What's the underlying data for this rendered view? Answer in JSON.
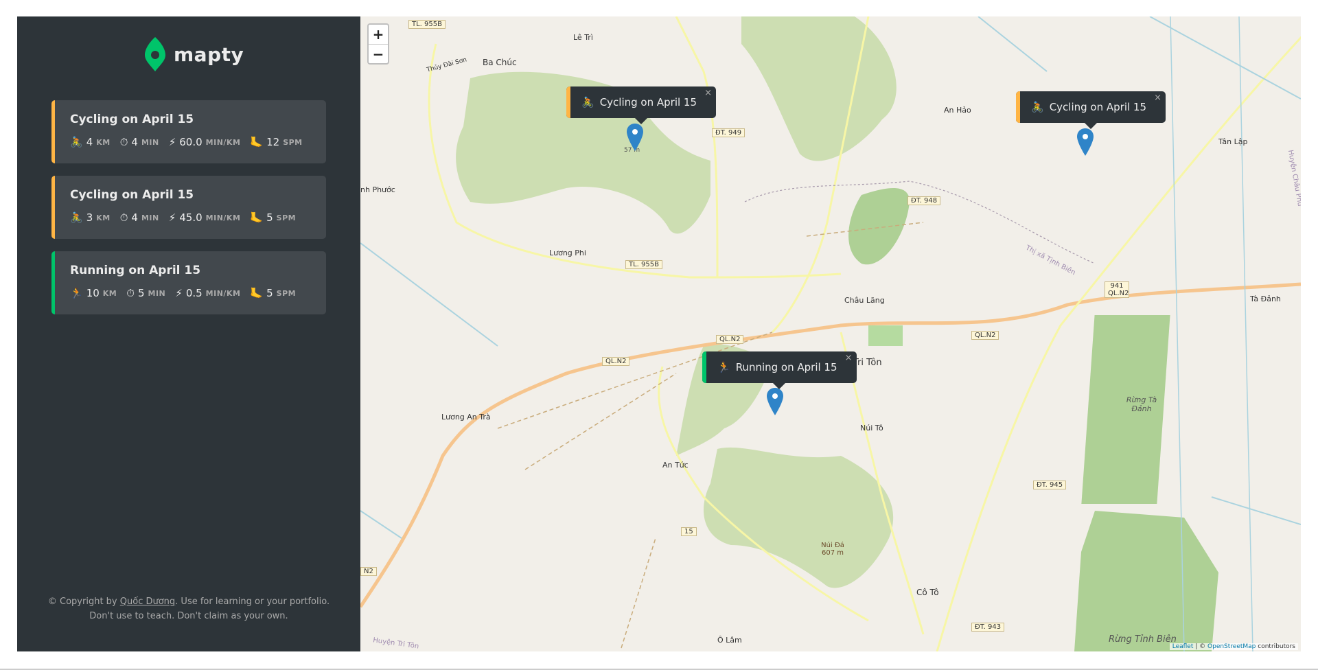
{
  "app": {
    "name": "mapty",
    "accent_cycling": "#ffb545",
    "accent_running": "#00c46a"
  },
  "workouts": [
    {
      "title": "Cycling on April 15",
      "type": "cycling",
      "icon": "🚴",
      "distance": "4",
      "distance_unit": "KM",
      "duration": "4",
      "duration_unit": "MIN",
      "pace": "60.0",
      "pace_unit": "MIN/KM",
      "cadence": "12",
      "cadence_unit": "SPM"
    },
    {
      "title": "Cycling on April 15",
      "type": "cycling",
      "icon": "🚴",
      "distance": "3",
      "distance_unit": "KM",
      "duration": "4",
      "duration_unit": "MIN",
      "pace": "45.0",
      "pace_unit": "MIN/KM",
      "cadence": "5",
      "cadence_unit": "SPM"
    },
    {
      "title": "Running on April 15",
      "type": "running",
      "icon": "🏃",
      "distance": "10",
      "distance_unit": "KM",
      "duration": "5",
      "duration_unit": "MIN",
      "pace": "0.5",
      "pace_unit": "MIN/KM",
      "cadence": "5",
      "cadence_unit": "SPM"
    }
  ],
  "icons": {
    "stopwatch": "⏱",
    "lightning": "⚡",
    "foot": "🦶"
  },
  "copyright": {
    "prefix": "© Copyright by ",
    "author": "Quốc Dương",
    "line1_suffix": ". Use for learning or your portfolio.",
    "line2": "Don't use to teach. Don't claim as your own."
  },
  "map": {
    "zoom_in": "+",
    "zoom_out": "−",
    "popups": [
      {
        "text": "Cycling on April 15",
        "icon": "🚴",
        "type": "cycling"
      },
      {
        "text": "Cycling on April 15",
        "icon": "🚴",
        "type": "cycling"
      },
      {
        "text": "Running on April 15",
        "icon": "🏃",
        "type": "running"
      }
    ],
    "places": [
      "Lê Trì",
      "Ba Chúc",
      "An Hảo",
      "Tân Lập",
      "Lương Phi",
      "Châu Lăng",
      "Tri Tôn",
      "Tà Đảnh",
      "Lương An Trà",
      "Núi Tô",
      "An Tức",
      "Cô Tô",
      "Ô Lâm",
      "Rừng Tà Đảnh",
      "Rừng Tỉnh Biên",
      "nh Phước",
      "Núi Đá 607 m",
      "Thị xã Tịnh Biên",
      "Huyện Tri Tôn",
      "Huyện Châu Phú",
      "57 m",
      "Thủy Đài Sơn"
    ],
    "road_labels": [
      "TL. 955B",
      "ĐT. 949",
      "ĐT. 948",
      "TL. 955B",
      "QL.N2",
      "QL.N2",
      "QL.N2",
      "941 QL.N2",
      "ĐT. 945",
      "ĐT. 943",
      "15",
      "N2"
    ],
    "close": "×",
    "attribution_leaflet": "Leaflet",
    "attribution_sep": " | © ",
    "attribution_osm": "OpenStreetMap",
    "attribution_suffix": " contributors"
  }
}
